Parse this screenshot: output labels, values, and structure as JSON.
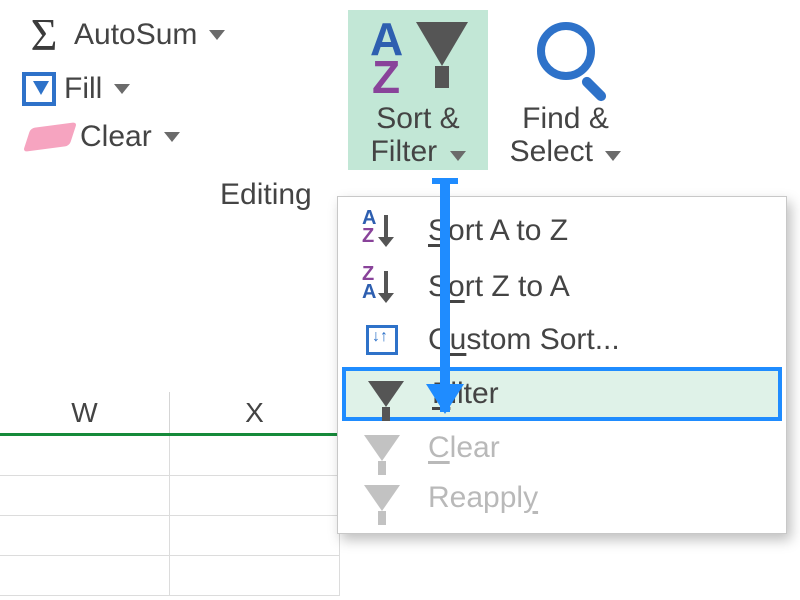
{
  "ribbon": {
    "autosum_label": "AutoSum",
    "fill_label": "Fill",
    "clear_label": "Clear",
    "group_title": "Editing",
    "sortfilter_line1": "Sort &",
    "sortfilter_line2": "Filter",
    "findselect_line1": "Find &",
    "findselect_line2": "Select"
  },
  "menu": {
    "sort_az": "Sort A to Z",
    "sort_za": "Sort Z to A",
    "custom_sort": "Custom Sort...",
    "filter": "Filter",
    "clear": "Clear",
    "reapply": "Reapply"
  },
  "sheet": {
    "columns": [
      "W",
      "X"
    ]
  },
  "icons": {
    "sigma": "Σ",
    "dropdown": "▼"
  },
  "colors": {
    "accent_blue": "#1f8cff",
    "az_a": "#2e5fb0",
    "az_z": "#89439a",
    "highlight_bg": "#c2e7d6"
  }
}
